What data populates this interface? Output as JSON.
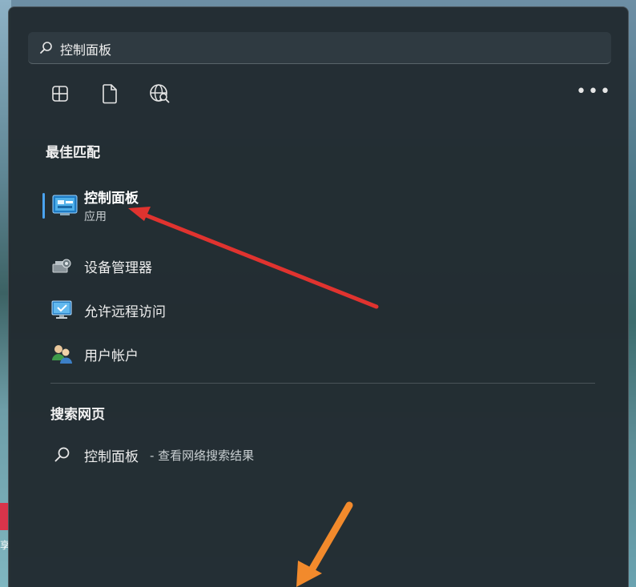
{
  "search": {
    "query": "控制面板"
  },
  "filters": [
    {
      "icon": "apps-icon"
    },
    {
      "icon": "document-icon"
    },
    {
      "icon": "web-search-icon"
    }
  ],
  "more_label": "•••",
  "best_match": {
    "heading": "最佳匹配",
    "name": "控制面板",
    "type": "应用"
  },
  "results": [
    {
      "label": "设备管理器",
      "icon": "device-manager-icon"
    },
    {
      "label": "允许远程访问",
      "icon": "remote-access-icon"
    },
    {
      "label": "用户帐户",
      "icon": "user-accounts-icon"
    }
  ],
  "web": {
    "heading": "搜索网页",
    "query": "控制面板",
    "suffix": "- 查看网络搜索结果"
  },
  "desktop": {
    "tile_text": "享"
  },
  "colors": {
    "accent": "#4aa3f0",
    "panel": "#222b31",
    "arrow_red": "#e0332f",
    "arrow_orange": "#f28a2c"
  }
}
